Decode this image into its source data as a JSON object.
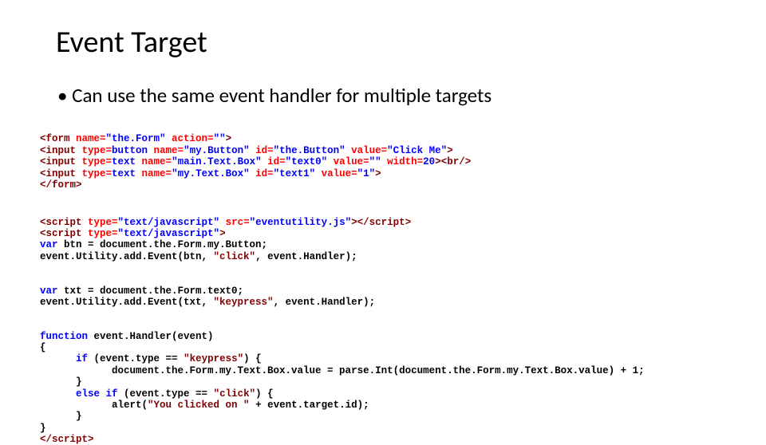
{
  "title": "Event Target",
  "bullet": "Can use the same event handler for multiple targets",
  "code1": {
    "l1": {
      "t1": "<form ",
      "a1": "name=",
      "v1": "\"the.Form\" ",
      "a2": "action=",
      "v2": "\"\"",
      "t2": ">"
    },
    "l2": {
      "t1": "<input ",
      "a1": "type=",
      "v1": "button ",
      "a2": "name=",
      "v2": "\"my.Button\" ",
      "a3": "id=",
      "v3": "\"the.Button\" ",
      "a4": "value=",
      "v4": "\"Click Me\"",
      "t2": ">"
    },
    "l3": {
      "t1": "<input ",
      "a1": "type=",
      "v1": "text ",
      "a2": "name=",
      "v2": "\"main.Text.Box\" ",
      "a3": "id=",
      "v3": "\"text0\" ",
      "a4": "value=",
      "v4": "\"\" ",
      "a5": "width=",
      "v5": "20",
      "t2": ">",
      "t3": "<br/>"
    },
    "l4": {
      "t1": "<input ",
      "a1": "type=",
      "v1": "text ",
      "a2": "name=",
      "v2": "\"my.Text.Box\" ",
      "a3": "id=",
      "v3": "\"text1\" ",
      "a4": "value=",
      "v4": "\"1\"",
      "t2": ">"
    },
    "l5": {
      "t1": "</form>"
    }
  },
  "code2": {
    "l1": {
      "t1": "<script ",
      "a1": "type=",
      "v1": "\"text/javascript\" ",
      "a2": "src=",
      "v2": "\"eventutility.js\"",
      "t2": ">",
      "t3": "</script>"
    },
    "l2": {
      "t1": "<script ",
      "a1": "type=",
      "v1": "\"text/javascript\"",
      "t2": ">"
    },
    "l3": {
      "k1": "var",
      "p1": " btn = document.the.Form.my.Button;"
    },
    "l4": {
      "p1": "event.Utility.add.Event(btn, ",
      "s1": "\"click\"",
      "p2": ", event.Handler);"
    }
  },
  "code3": {
    "l1": {
      "k1": "var",
      "p1": " txt = document.the.Form.text0;"
    },
    "l2": {
      "p1": "event.Utility.add.Event(txt, ",
      "s1": "\"keypress\"",
      "p2": ", event.Handler);"
    }
  },
  "code4": {
    "l1": {
      "k1": "function",
      "p1": " event.Handler(event)"
    },
    "l2": {
      "p1": "{"
    },
    "l3": {
      "p1": "      ",
      "k1": "if",
      "p2": " (event.type == ",
      "s1": "\"keypress\"",
      "p3": ") {"
    },
    "l4": {
      "p1": "            document.the.Form.my.Text.Box.value = parse.Int(document.the.Form.my.Text.Box.value) + 1;"
    },
    "l5": {
      "p1": "      }"
    },
    "l6": {
      "p1": "      ",
      "k1": "else if",
      "p2": " (event.type == ",
      "s1": "\"click\"",
      "p3": ") {"
    },
    "l7": {
      "p1": "            alert(",
      "s1": "\"You clicked on \"",
      "p2": " + event.target.id);"
    },
    "l8": {
      "p1": "      }"
    },
    "l9": {
      "p1": "}"
    },
    "l10": {
      "t1": "</script>"
    }
  }
}
